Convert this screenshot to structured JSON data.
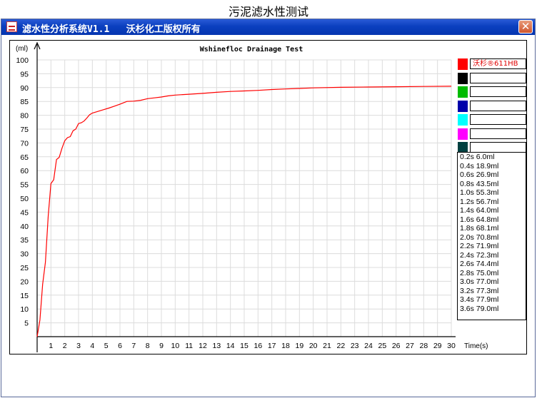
{
  "page_title": "污泥滤水性测试",
  "window": {
    "title": "滤水性分析系统V1.1   沃杉化工版权所有",
    "close_glyph": "✕"
  },
  "legend": [
    {
      "color": "#ff0000",
      "label": "沃杉®611HB",
      "text_color": "#e00000"
    },
    {
      "color": "#000000",
      "label": ""
    },
    {
      "color": "#00bb00",
      "label": ""
    },
    {
      "color": "#0000aa",
      "label": ""
    },
    {
      "color": "#00ffff",
      "label": ""
    },
    {
      "color": "#ff00ff",
      "label": ""
    },
    {
      "color": "#004040",
      "label": ""
    }
  ],
  "readings": [
    "0.2s 6.0ml",
    "0.4s 18.9ml",
    "0.6s 26.9ml",
    "0.8s 43.5ml",
    "1.0s 55.3ml",
    "1.2s 56.7ml",
    "1.4s 64.0ml",
    "1.6s 64.8ml",
    "1.8s 68.1ml",
    "2.0s 70.8ml",
    "2.2s 71.9ml",
    "2.4s 72.3ml",
    "2.6s 74.4ml",
    "2.8s 75.0ml",
    "3.0s 77.0ml",
    "3.2s 77.3ml",
    "3.4s 77.9ml",
    "3.6s 79.0ml"
  ],
  "chart_data": {
    "type": "line",
    "title": "Wshinefloc Drainage Test",
    "xlabel": "Time(s)",
    "ylabel": "(ml)",
    "xlim": [
      0,
      30
    ],
    "ylim": [
      0,
      100
    ],
    "x_ticks": [
      1,
      2,
      3,
      4,
      5,
      6,
      7,
      8,
      9,
      10,
      11,
      12,
      13,
      14,
      15,
      16,
      17,
      18,
      19,
      20,
      21,
      22,
      23,
      24,
      25,
      26,
      27,
      28,
      29,
      30
    ],
    "y_ticks": [
      5,
      10,
      15,
      20,
      25,
      30,
      35,
      40,
      45,
      50,
      55,
      60,
      65,
      70,
      75,
      80,
      85,
      90,
      95,
      100
    ],
    "grid": true,
    "series": [
      {
        "name": "沃杉®611HB",
        "color": "#ff0000",
        "x": [
          0,
          0.2,
          0.4,
          0.6,
          0.8,
          1.0,
          1.2,
          1.4,
          1.6,
          1.8,
          2.0,
          2.2,
          2.4,
          2.6,
          2.8,
          3.0,
          3.2,
          3.4,
          3.6,
          3.8,
          4.0,
          4.4,
          4.8,
          5.2,
          5.6,
          6.0,
          6.5,
          7.0,
          7.5,
          8.0,
          8.5,
          9.0,
          9.5,
          10,
          11,
          12,
          13,
          14,
          15,
          16,
          17,
          18,
          19,
          20,
          22,
          24,
          26,
          28,
          30
        ],
        "y": [
          0,
          6.0,
          18.9,
          26.9,
          43.5,
          55.3,
          56.7,
          64.0,
          64.8,
          68.1,
          70.8,
          71.9,
          72.3,
          74.4,
          75.0,
          77.0,
          77.3,
          77.9,
          79.0,
          80.2,
          80.8,
          81.4,
          82.0,
          82.6,
          83.3,
          84.0,
          85.0,
          85.1,
          85.4,
          86.0,
          86.3,
          86.6,
          87.0,
          87.3,
          87.6,
          87.9,
          88.3,
          88.6,
          88.8,
          89.0,
          89.3,
          89.5,
          89.7,
          89.9,
          90.1,
          90.2,
          90.3,
          90.4,
          90.5
        ]
      }
    ]
  }
}
